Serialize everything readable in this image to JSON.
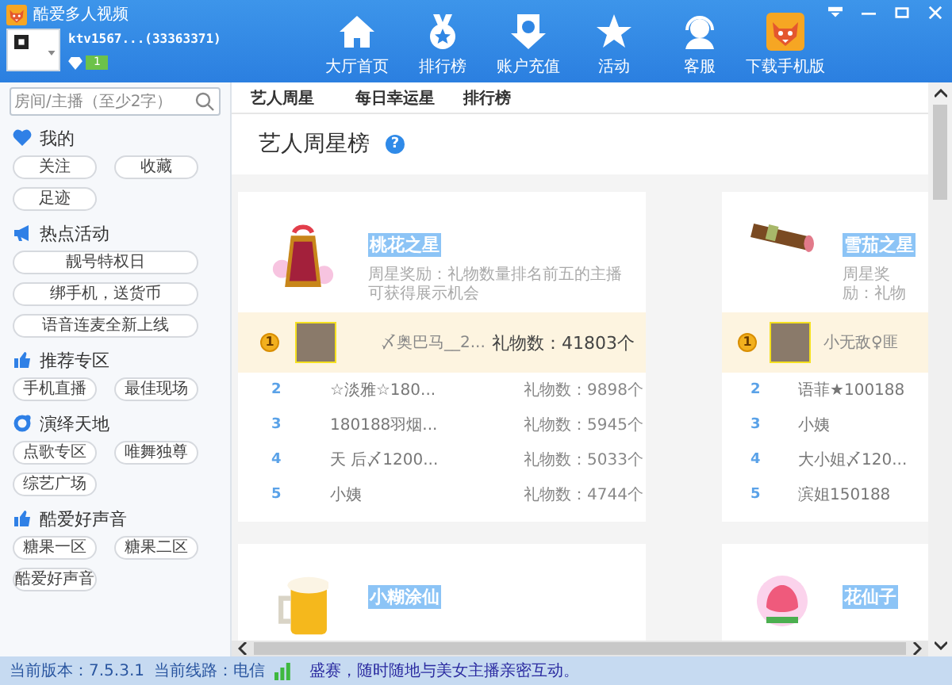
{
  "window": {
    "title": "酷爱多人视频"
  },
  "user": {
    "name": "ktv1567...(33363371)",
    "level": "1"
  },
  "nav": [
    {
      "label": "大厅首页",
      "kind": "home"
    },
    {
      "label": "排行榜",
      "kind": "medal"
    },
    {
      "label": "账户充值",
      "kind": "coin"
    },
    {
      "label": "活动",
      "kind": "star"
    },
    {
      "label": "客服",
      "kind": "headset"
    },
    {
      "label": "下载手机版",
      "kind": "app"
    }
  ],
  "search": {
    "placeholder": "房间/主播（至少2字）"
  },
  "sidebar": [
    {
      "title": "我的",
      "kind": "heart",
      "items": [
        {
          "label": "关注",
          "kind": "short"
        },
        {
          "label": "收藏",
          "kind": "short"
        },
        {
          "label": "足迹",
          "kind": "short"
        }
      ]
    },
    {
      "title": "热点活动",
      "kind": "megaphone",
      "items": [
        {
          "label": "靓号特权日",
          "kind": "wide"
        },
        {
          "label": "绑手机，送货币",
          "kind": "wide"
        },
        {
          "label": "语音连麦全新上线",
          "kind": "wide"
        }
      ]
    },
    {
      "title": "推荐专区",
      "kind": "thumb",
      "items": [
        {
          "label": "手机直播",
          "kind": "short"
        },
        {
          "label": "最佳现场",
          "kind": "short"
        }
      ]
    },
    {
      "title": "演绎天地",
      "kind": "swirl",
      "items": [
        {
          "label": "点歌专区",
          "kind": "short"
        },
        {
          "label": "唯舞独尊",
          "kind": "short"
        },
        {
          "label": "综艺广场",
          "kind": "short"
        }
      ]
    },
    {
      "title": "酷爱好声音",
      "kind": "thumb",
      "items": [
        {
          "label": "糖果一区",
          "kind": "short"
        },
        {
          "label": "糖果二区",
          "kind": "short"
        },
        {
          "label": "酷爱好声音",
          "kind": "short"
        }
      ]
    }
  ],
  "tabs": [
    "艺人周星",
    "每日幸运星",
    "排行榜"
  ],
  "page_title": "艺人周星榜",
  "help": "?",
  "cards": [
    {
      "kind": "pouch",
      "title": "桃花之星",
      "desc": "周星奖励：礼物数量排名前五的主播可获得展示机会",
      "top": {
        "rank": "1",
        "name": "〆奥巴马__2...",
        "gifts": "礼物数：41803个"
      },
      "rows": [
        {
          "rank": "2",
          "name": "☆淡雅☆180...",
          "gifts": "礼物数：9898个"
        },
        {
          "rank": "3",
          "name": "180188羽烟...",
          "gifts": "礼物数：5945个"
        },
        {
          "rank": "4",
          "name": "天 后〆1200...",
          "gifts": "礼物数：5033个"
        },
        {
          "rank": "5",
          "name": "小姨",
          "gifts": "礼物数：4744个"
        }
      ]
    },
    {
      "kind": "cigar",
      "title": "雪茄之星",
      "desc": "周星奖励：礼物",
      "top": {
        "rank": "1",
        "name": "小无敌♀匪"
      },
      "rows": [
        {
          "rank": "2",
          "name": "语菲★100188"
        },
        {
          "rank": "3",
          "name": "小姨"
        },
        {
          "rank": "4",
          "name": "大小姐〆120..."
        },
        {
          "rank": "5",
          "name": "滨姐150188"
        }
      ]
    },
    {
      "kind": "beer",
      "title": "小糊涂仙"
    },
    {
      "kind": "flower",
      "title": "花仙子"
    }
  ],
  "status": {
    "version": "当前版本：7.5.3.1",
    "line": "当前线路：电信",
    "marquee": "盛赛，随时随地与美女主播亲密互动。"
  }
}
